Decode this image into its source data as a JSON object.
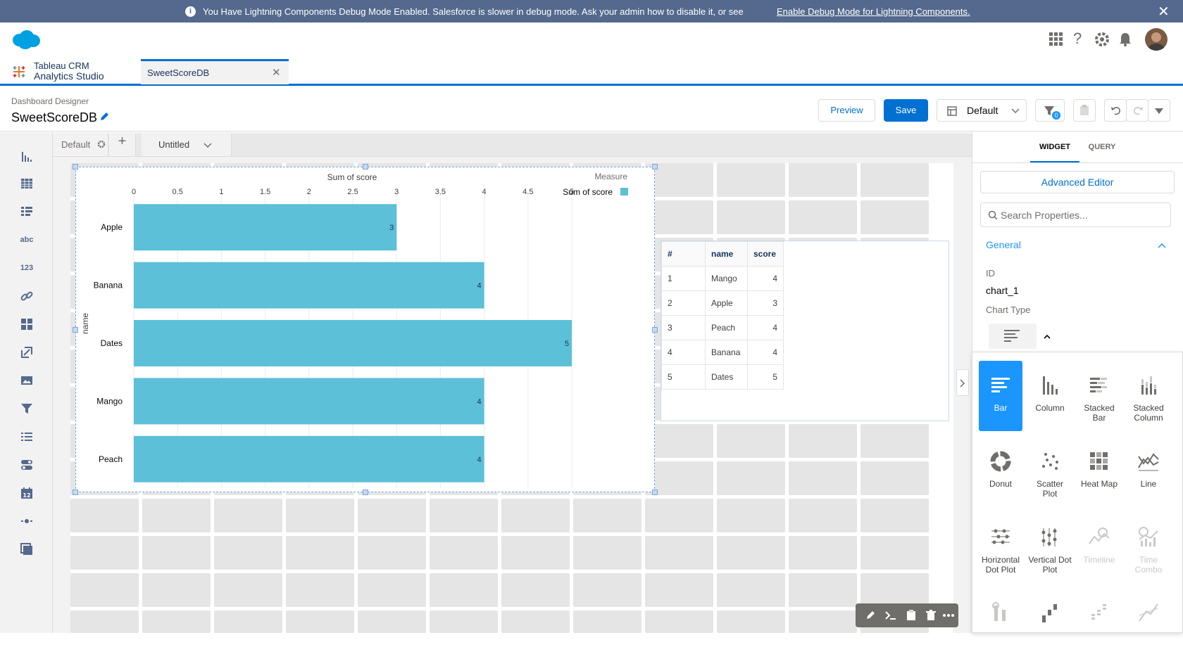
{
  "debug_banner": {
    "message": "You Have Lightning Components Debug Mode Enabled. Salesforce is slower in debug mode. Ask your admin how to disable it, or see",
    "link": "Enable Debug Mode for Lightning Components.",
    "close": "✕"
  },
  "app": {
    "name_line1": "Tableau CRM",
    "name_line2": "Analytics Studio"
  },
  "tabs": [
    {
      "label": "SweetScoreDB",
      "close": "✕"
    }
  ],
  "designer": {
    "breadcrumb": "Dashboard Designer",
    "title": "SweetScoreDB",
    "preview_label": "Preview",
    "save_label": "Save",
    "layout_label": "Default",
    "filter_badge": "0"
  },
  "pagebar": {
    "page_label": "Default",
    "add": "+",
    "page_name": "Untitled"
  },
  "chart_data": {
    "type": "bar",
    "orientation": "horizontal",
    "categories": [
      "Apple",
      "Banana",
      "Dates",
      "Mango",
      "Peach"
    ],
    "series": [
      {
        "name": "Sum of score",
        "values": [
          3,
          4,
          5,
          4,
          4
        ]
      }
    ],
    "xlabel": "Sum of score",
    "ylabel": "name",
    "xlim": [
      0,
      5
    ],
    "xticks": [
      "0",
      "0.5",
      "1",
      "1.5",
      "2",
      "2.5",
      "3",
      "3.5",
      "4",
      "4.5",
      "5"
    ],
    "legend_title": "Measure",
    "legend_position": "top-right",
    "bar_color": "#5bc0d8",
    "grid": true
  },
  "table": {
    "headers": [
      "#",
      "name",
      "score"
    ],
    "rows": [
      [
        "1",
        "Mango",
        "4"
      ],
      [
        "2",
        "Apple",
        "3"
      ],
      [
        "3",
        "Peach",
        "4"
      ],
      [
        "4",
        "Banana",
        "4"
      ],
      [
        "5",
        "Dates",
        "5"
      ]
    ]
  },
  "panel": {
    "tab_widget": "WIDGET",
    "tab_query": "QUERY",
    "advanced_editor": "Advanced Editor",
    "search_placeholder": "Search Properties...",
    "section_general": "General",
    "id_label": "ID",
    "id_value": "chart_1",
    "chart_type_label": "Chart Type"
  },
  "chart_types": [
    {
      "label": "Bar",
      "icon": "bar-chart-icon",
      "selected": true
    },
    {
      "label": "Column",
      "icon": "column-chart-icon"
    },
    {
      "label": "Stacked Bar",
      "icon": "stacked-bar-icon"
    },
    {
      "label": "Stacked Column",
      "icon": "stacked-column-icon"
    },
    {
      "label": "Donut",
      "icon": "donut-icon"
    },
    {
      "label": "Scatter Plot",
      "icon": "scatter-plot-icon"
    },
    {
      "label": "Heat Map",
      "icon": "heat-map-icon"
    },
    {
      "label": "Line",
      "icon": "line-chart-icon"
    },
    {
      "label": "Horizontal Dot Plot",
      "icon": "horizontal-dot-plot-icon"
    },
    {
      "label": "Vertical Dot Plot",
      "icon": "vertical-dot-plot-icon"
    },
    {
      "label": "Timeline",
      "icon": "timeline-icon",
      "disabled": true
    },
    {
      "label": "Time Combo",
      "icon": "time-combo-icon",
      "disabled": true
    }
  ],
  "colors": {
    "brand": "#0070d2",
    "banner": "#54698d",
    "selected_chart_type": "#1b96ff"
  }
}
